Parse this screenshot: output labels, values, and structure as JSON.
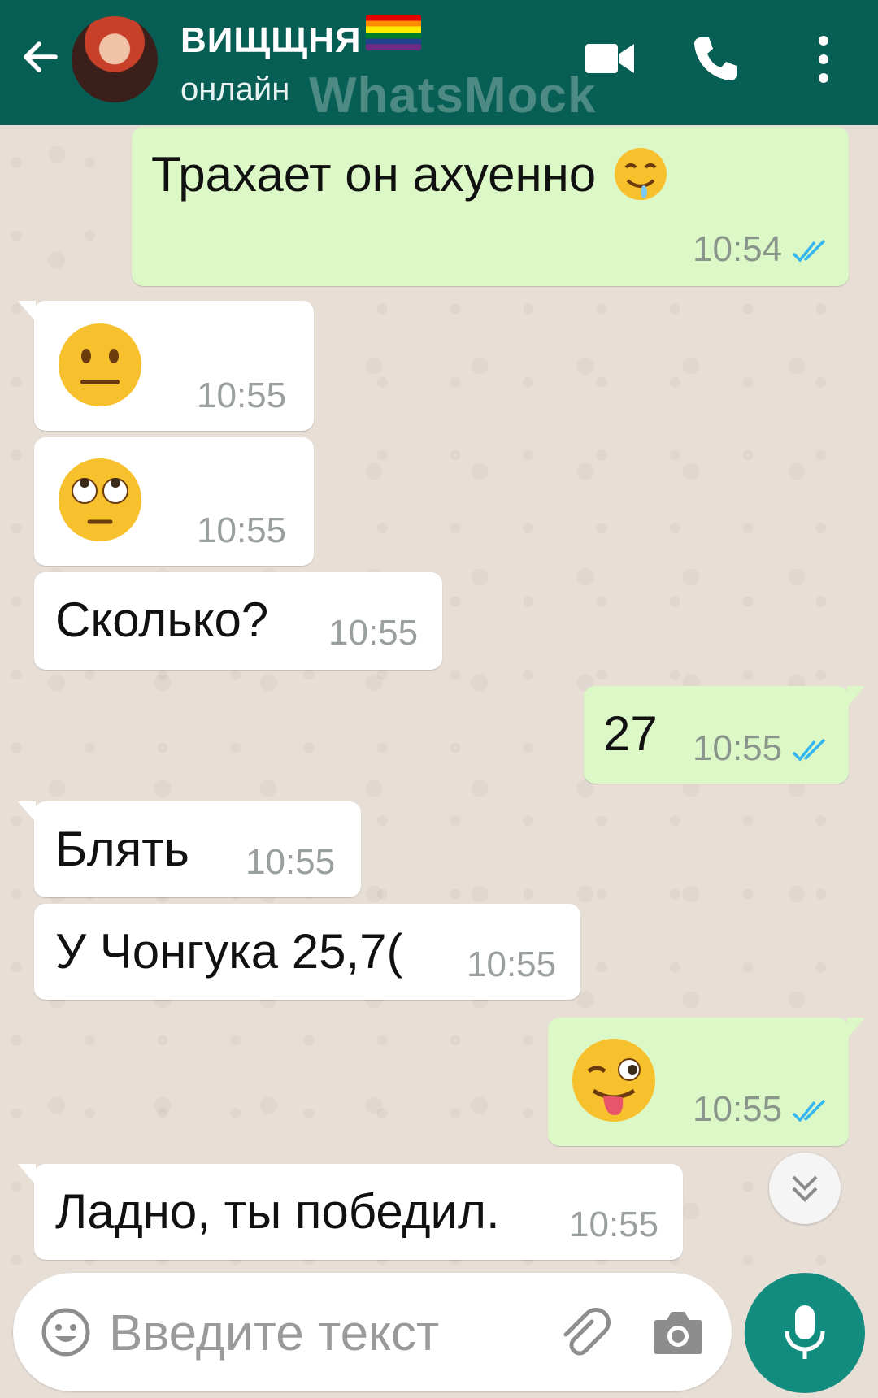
{
  "header": {
    "contact_name": "ВИЩЩНЯ",
    "status": "онлайн",
    "watermark": "WhatsMock",
    "accent_color": "#075e54"
  },
  "messages": [
    {
      "direction": "out",
      "text": "Трахает он ахуенно",
      "emoji": "drooling-face",
      "time": "10:54",
      "read": true
    },
    {
      "direction": "in",
      "text": "",
      "emoji": "neutral-face",
      "time": "10:55"
    },
    {
      "direction": "in",
      "text": "",
      "emoji": "rolling-eyes-face",
      "time": "10:55"
    },
    {
      "direction": "in",
      "text": "Сколько?",
      "time": "10:55"
    },
    {
      "direction": "out",
      "text": "27",
      "time": "10:55",
      "read": true
    },
    {
      "direction": "in",
      "text": "Блять",
      "time": "10:55"
    },
    {
      "direction": "in",
      "text": "У Чонгука 25,7(",
      "time": "10:55"
    },
    {
      "direction": "out",
      "text": "",
      "emoji": "winking-tongue-face",
      "time": "10:55",
      "read": true
    },
    {
      "direction": "in",
      "text": "Ладно, ты победил.",
      "time": "10:55"
    }
  ],
  "composer": {
    "placeholder": "Введите текст"
  },
  "colors": {
    "outgoing_bubble": "#dcf8c6",
    "incoming_bubble": "#ffffff",
    "read_ticks": "#34b7f1",
    "mic_button": "#128c7e"
  }
}
